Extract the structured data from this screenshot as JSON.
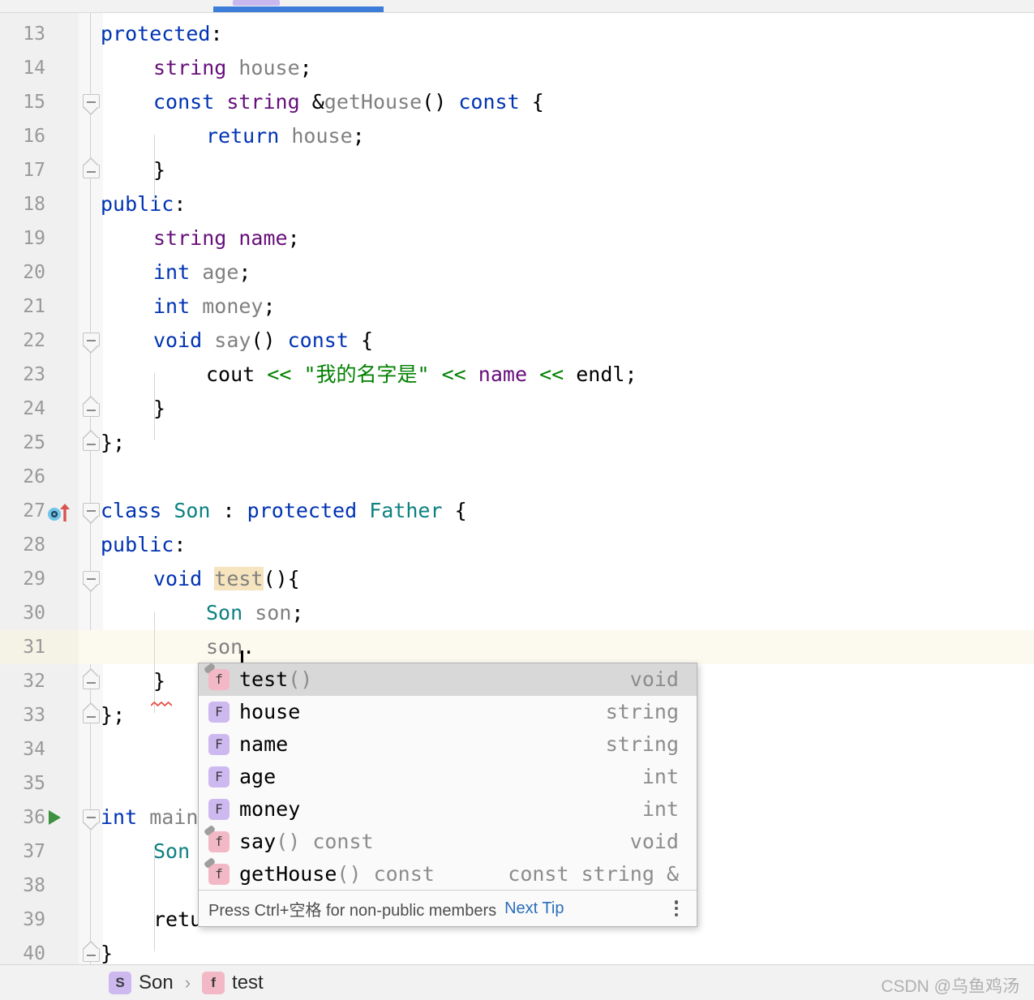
{
  "tab": {
    "active": true
  },
  "editor": {
    "first_line": 13,
    "lines": [
      {
        "num": 13,
        "indent": 0,
        "text": "protected:"
      },
      {
        "num": 14,
        "indent": 1,
        "text": "string house;"
      },
      {
        "num": 15,
        "indent": 1,
        "text": "const string &getHouse() const {"
      },
      {
        "num": 16,
        "indent": 2,
        "text": "return house;"
      },
      {
        "num": 17,
        "indent": 1,
        "text": "}"
      },
      {
        "num": 18,
        "indent": 0,
        "text": "public:"
      },
      {
        "num": 19,
        "indent": 1,
        "text": "string name;"
      },
      {
        "num": 20,
        "indent": 1,
        "text": "int age;"
      },
      {
        "num": 21,
        "indent": 1,
        "text": "int money;"
      },
      {
        "num": 22,
        "indent": 1,
        "text": "void say() const {"
      },
      {
        "num": 23,
        "indent": 2,
        "text": "cout << \"我的名字是\" << name << endl;"
      },
      {
        "num": 24,
        "indent": 1,
        "text": "}"
      },
      {
        "num": 25,
        "indent": 0,
        "text": "};"
      },
      {
        "num": 26,
        "indent": 0,
        "text": ""
      },
      {
        "num": 27,
        "indent": 0,
        "text": "class Son : protected Father {"
      },
      {
        "num": 28,
        "indent": 0,
        "text": "public:"
      },
      {
        "num": 29,
        "indent": 1,
        "text": "void test(){"
      },
      {
        "num": 30,
        "indent": 2,
        "text": "Son son;"
      },
      {
        "num": 31,
        "indent": 2,
        "text": "son."
      },
      {
        "num": 32,
        "indent": 1,
        "text": "}"
      },
      {
        "num": 33,
        "indent": 0,
        "text": "};"
      },
      {
        "num": 34,
        "indent": 0,
        "text": ""
      },
      {
        "num": 35,
        "indent": 0,
        "text": ""
      },
      {
        "num": 36,
        "indent": 0,
        "text": "int main"
      },
      {
        "num": 37,
        "indent": 1,
        "text": "Son"
      },
      {
        "num": 38,
        "indent": 0,
        "text": ""
      },
      {
        "num": 39,
        "indent": 1,
        "text": "retu"
      },
      {
        "num": 40,
        "indent": 0,
        "text": "}"
      }
    ],
    "current_line": 31,
    "highlighted_identifier": "test",
    "gutter_icons": [
      {
        "line": 27,
        "icon": "inheritance-marker-icon"
      },
      {
        "line": 36,
        "icon": "run-gutter-icon"
      }
    ]
  },
  "autocomplete": {
    "items": [
      {
        "kind": "method",
        "badge": "f",
        "name": "test",
        "suffix": "()",
        "modifier": "",
        "type": "void",
        "selected": true
      },
      {
        "kind": "field",
        "badge": "F",
        "name": "house",
        "suffix": "",
        "modifier": "",
        "type": "string",
        "selected": false
      },
      {
        "kind": "field",
        "badge": "F",
        "name": "name",
        "suffix": "",
        "modifier": "",
        "type": "string",
        "selected": false
      },
      {
        "kind": "field",
        "badge": "F",
        "name": "age",
        "suffix": "",
        "modifier": "",
        "type": "int",
        "selected": false
      },
      {
        "kind": "field",
        "badge": "F",
        "name": "money",
        "suffix": "",
        "modifier": "",
        "type": "int",
        "selected": false
      },
      {
        "kind": "method",
        "badge": "f",
        "name": "say",
        "suffix": "()",
        "modifier": " const",
        "type": "void",
        "selected": false
      },
      {
        "kind": "method",
        "badge": "f",
        "name": "getHouse",
        "suffix": "()",
        "modifier": " const",
        "type": "const string &",
        "selected": false
      }
    ],
    "footer": {
      "hint": "Press Ctrl+空格 for non-public members",
      "next_tip": "Next Tip",
      "menu_icon": "kebab-menu-icon"
    }
  },
  "breadcrumb": {
    "items": [
      {
        "badge": "S",
        "kind": "class",
        "label": "Son"
      },
      {
        "badge": "f",
        "kind": "method",
        "label": "test"
      }
    ],
    "separator": "›"
  },
  "watermark": {
    "text": "CSDN @乌鱼鸡汤"
  },
  "colors": {
    "keyword": "#0033b3",
    "type": "#0d8080",
    "field": "#660e7a",
    "string": "#008000",
    "function": "#808080",
    "current_line_bg": "#fcfaef",
    "identifier_highlight": "#f5e4bd",
    "selection_bg": "#d8d8d8",
    "tab_accent": "#3b7dd8",
    "method_badge": "#f2b8c6",
    "field_badge": "#cdb9f0"
  }
}
